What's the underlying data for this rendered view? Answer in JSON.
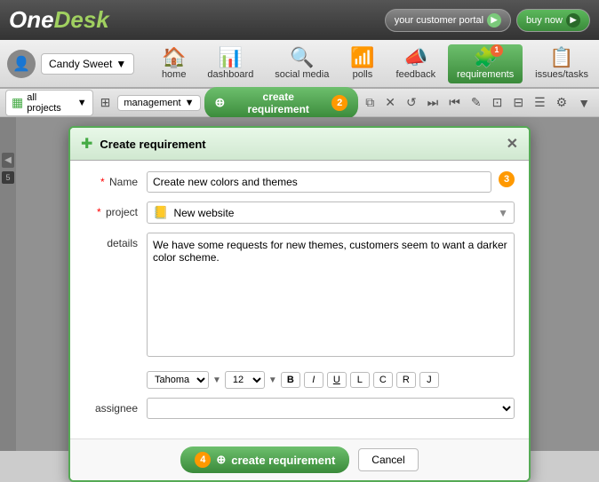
{
  "logo": {
    "one": "One",
    "desk": "Desk"
  },
  "topbar": {
    "portal_label": "your customer portal",
    "buynow_label": "buy now"
  },
  "user": {
    "name": "Candy Sweet",
    "avatar_icon": "👤"
  },
  "nav": {
    "items": [
      {
        "id": "home",
        "label": "home",
        "icon": "🏠",
        "active": false
      },
      {
        "id": "dashboard",
        "label": "dashboard",
        "icon": "📊",
        "active": false
      },
      {
        "id": "social",
        "label": "social media",
        "icon": "🔍",
        "active": false
      },
      {
        "id": "polls",
        "label": "polls",
        "icon": "📶",
        "active": false
      },
      {
        "id": "feedback",
        "label": "feedback",
        "icon": "📣",
        "active": false
      },
      {
        "id": "requirements",
        "label": "requirements",
        "icon": "🧩",
        "active": true
      },
      {
        "id": "issues",
        "label": "issues/tasks",
        "icon": "📋",
        "active": false
      }
    ],
    "badge_num": "1"
  },
  "toolbar": {
    "project_label": "all projects",
    "management_label": "management",
    "create_label": "create requirement",
    "step_badge": "2"
  },
  "modal": {
    "title": "Create requirement",
    "close_label": "✕",
    "step_badge": "3",
    "fields": {
      "name_label": "Name",
      "name_value": "Create new colors and themes",
      "project_label": "project",
      "project_value": "New website",
      "details_label": "details",
      "details_value": "We have some requests for new themes, customers seem to want a darker color scheme.",
      "assignee_label": "assignee"
    },
    "formatting": {
      "font": "Tahoma",
      "size": "12",
      "bold": "B",
      "italic": "I",
      "underline": "U",
      "align_l": "L",
      "align_c": "C",
      "align_r": "R",
      "align_j": "J"
    },
    "footer": {
      "submit_label": "create requirement",
      "cancel_label": "Cancel",
      "step_badge": "4"
    }
  }
}
